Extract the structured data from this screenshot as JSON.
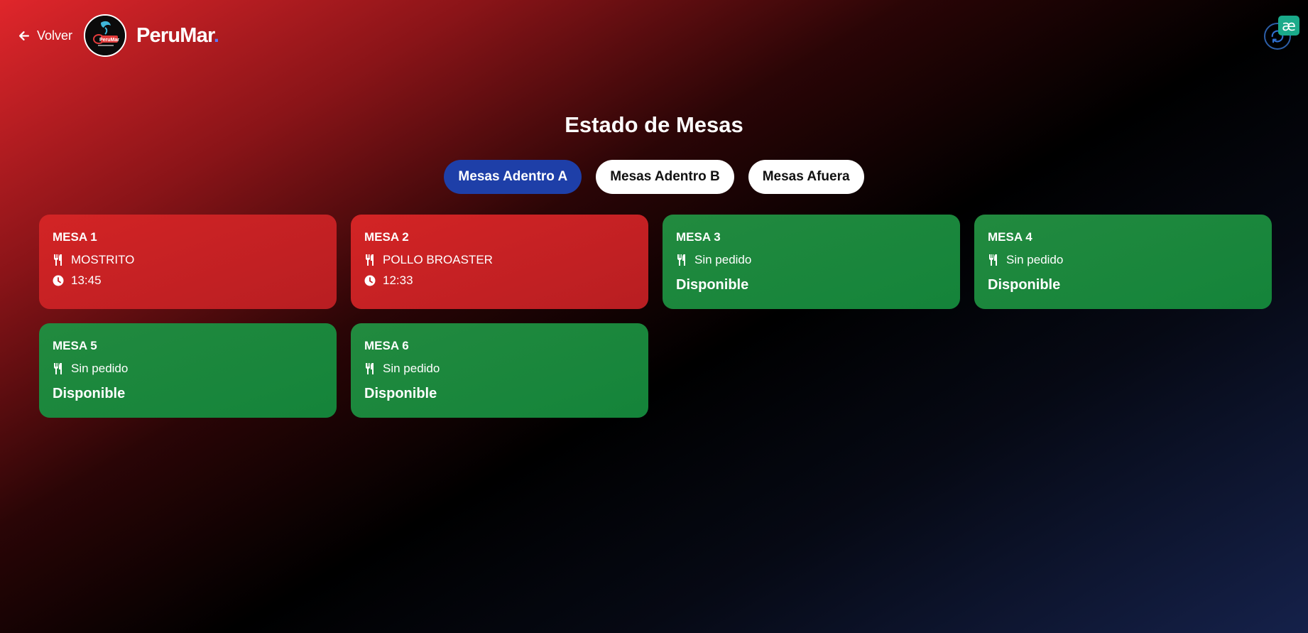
{
  "header": {
    "back_label": "Volver",
    "brand": "PeruMar",
    "brand_dot": ".",
    "logo_text": "PeruMar"
  },
  "extension_badge": "æ",
  "page_title": "Estado de Mesas",
  "tabs": [
    {
      "label": "Mesas Adentro A",
      "active": true
    },
    {
      "label": "Mesas Adentro B",
      "active": false
    },
    {
      "label": "Mesas Afuera",
      "active": false
    }
  ],
  "tables": [
    {
      "name": "MESA 1",
      "order": "MOSTRITO",
      "time": "13:45",
      "state": "occupied"
    },
    {
      "name": "MESA 2",
      "order": "POLLO BROASTER",
      "time": "12:33",
      "state": "occupied"
    },
    {
      "name": "MESA 3",
      "order": "Sin pedido",
      "status": "Disponible",
      "state": "free"
    },
    {
      "name": "MESA 4",
      "order": "Sin pedido",
      "status": "Disponible",
      "state": "free"
    },
    {
      "name": "MESA 5",
      "order": "Sin pedido",
      "status": "Disponible",
      "state": "free"
    },
    {
      "name": "MESA 6",
      "order": "Sin pedido",
      "status": "Disponible",
      "state": "free"
    }
  ],
  "colors": {
    "occupied": "#c82024",
    "free": "#1b873c",
    "active_tab": "#1e3fa8"
  }
}
